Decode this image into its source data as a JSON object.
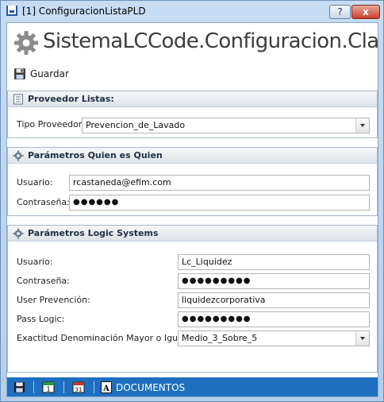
{
  "window": {
    "title": "[1] ConfiguracionListaPLD",
    "help_label": "?",
    "close_label": "x",
    "app_icon": "window-app-icon"
  },
  "header": {
    "title": "SistemaLCCode.Configuracion.Clases.C",
    "icon": "gear-icon"
  },
  "toolbar": {
    "save_label": "Guardar",
    "save_icon": "floppy-disk-icon"
  },
  "panels": {
    "proveedor": {
      "title": "Proveedor Listas:",
      "icon": "list-icon",
      "tipo_label": "Tipo Proveedor:",
      "tipo_value": "Prevencion_de_Lavado"
    },
    "quien": {
      "title": "Parámetros Quien es Quien",
      "icon": "gear-icon",
      "usuario_label": "Usuario:",
      "usuario_value": "rcastaneda@efim.com",
      "password_label": "Contraseña:",
      "password_value": "●●●●●●"
    },
    "logic": {
      "title": "Parámetros Logic Systems",
      "icon": "gear-icon",
      "usuario_label": "Usuario:",
      "usuario_value": "Lc_Liquidez",
      "password_label": "Contraseña:",
      "password_value": "●●●●●●●●●",
      "user_prev_label": "User Prevención:",
      "user_prev_value": "liquidezcorporativa",
      "pass_logic_label": "Pass Logic:",
      "pass_logic_value": "●●●●●●●●●",
      "exactitud_label": "Exactitud Denominación Mayor o Igual a:",
      "exactitud_value": "Medio_3_Sobre_5"
    }
  },
  "bottombar": {
    "documentos_label": "DOCUMENTOS",
    "items": [
      "floppy-disk-icon",
      "calendar-1-icon",
      "calendar-31-icon",
      "document-a-icon"
    ],
    "bg_color": "#1e6fbf"
  }
}
